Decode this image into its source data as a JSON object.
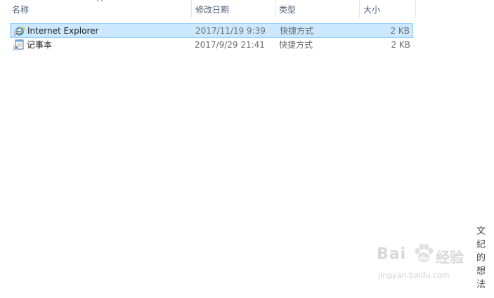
{
  "columns": {
    "name": "名称",
    "modified": "修改日期",
    "type": "类型",
    "size": "大小"
  },
  "files": [
    {
      "name": "Internet Explorer",
      "modified": "2017/11/19 9:39",
      "type": "快捷方式",
      "size": "2 KB",
      "icon": "internet-explorer-icon",
      "selected": true
    },
    {
      "name": "记事本",
      "modified": "2017/9/29 21:41",
      "type": "快捷方式",
      "size": "2 KB",
      "icon": "notepad-icon",
      "selected": false
    }
  ],
  "watermark": {
    "baidu_logo": "Bai",
    "jingyan": "经验",
    "url": "jingyan.baidu.com",
    "author_vertical": "文纪的想法"
  },
  "colors": {
    "selection_bg": "#cce8ff",
    "selection_border": "#99d1ff",
    "header_text": "#4c607a"
  }
}
